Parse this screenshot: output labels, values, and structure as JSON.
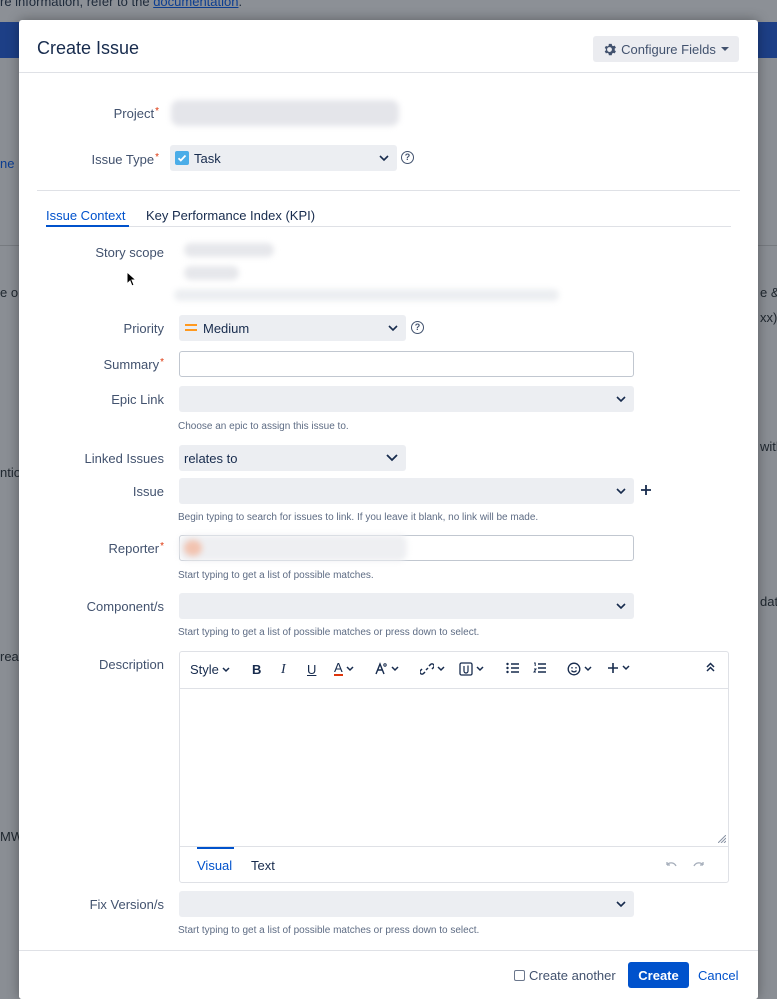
{
  "background": {
    "top_text_prefix": "re information, refer to the",
    "top_link": "documentation",
    "top_text_suffix": ".",
    "fragments_left": [
      "ne",
      "e or",
      "ntion",
      "reat",
      "MW"
    ],
    "fragments_right": [
      "e &",
      "xx)",
      "with",
      "dato"
    ]
  },
  "dialog": {
    "title": "Create Issue",
    "configure_fields_label": "Configure Fields"
  },
  "form": {
    "project": {
      "label": "Project"
    },
    "issue_type": {
      "label": "Issue Type",
      "value": "Task"
    },
    "tabs": [
      {
        "label": "Issue Context",
        "active": true
      },
      {
        "label": "Key Performance Index (KPI)",
        "active": false
      }
    ],
    "story_scope": {
      "label": "Story scope"
    },
    "priority": {
      "label": "Priority",
      "value": "Medium"
    },
    "summary": {
      "label": "Summary",
      "value": ""
    },
    "epic_link": {
      "label": "Epic Link",
      "value": "",
      "hint": "Choose an epic to assign this issue to."
    },
    "linked_issues": {
      "label": "Linked Issues",
      "value": "relates to"
    },
    "issue": {
      "label": "Issue",
      "value": "",
      "hint": "Begin typing to search for issues to link. If you leave it blank, no link will be made."
    },
    "reporter": {
      "label": "Reporter",
      "hint": "Start typing to get a list of possible matches."
    },
    "components": {
      "label": "Component/s",
      "value": "",
      "hint": "Start typing to get a list of possible matches or press down to select."
    },
    "description": {
      "label": "Description",
      "toolbar": {
        "style_label": "Style",
        "bold": "B",
        "italic": "I",
        "underline": "U",
        "text_color": "A"
      },
      "tab_visual": "Visual",
      "tab_text": "Text"
    },
    "fix_versions": {
      "label": "Fix Version/s",
      "value": "",
      "hint": "Start typing to get a list of possible matches or press down to select."
    }
  },
  "footer": {
    "create_another_label": "Create another",
    "create_label": "Create",
    "cancel_label": "Cancel"
  },
  "colors": {
    "primary": "#0052cc",
    "required": "#de350b",
    "priority_medium": "#ff991f"
  }
}
